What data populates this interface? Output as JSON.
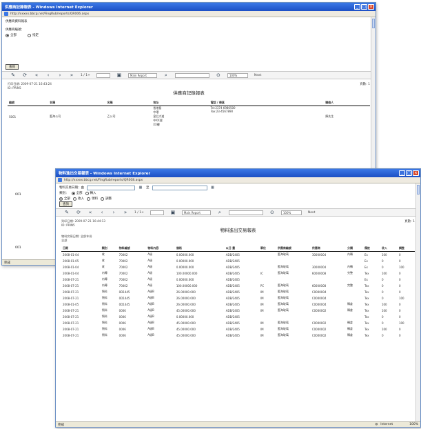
{
  "back_window": {
    "title": "供應商記錄報表 - Windows Internet Explorer",
    "url": "http://xxxxx.bbcg.net/FingRub/reports/QR006.aspx",
    "breadcrumb": "供應商資料報表",
    "filter_label": "供應商編號：",
    "radio_all": "全部",
    "radio_select": "指定",
    "query_button": "查詢",
    "toolbar": {
      "page": "1 / 1+",
      "export_format": "Main Report",
      "zoom": "100%",
      "next": "Next"
    },
    "report": {
      "print_time": "打印日期: 2009-07-21 16:43:24",
      "user": "ID: PRIN5",
      "title": "供應商記錄報表",
      "page_label": "頁數: 1"
    },
    "table": {
      "headers": [
        "編號",
        "名稱",
        "名稱",
        "地址",
        "電話 / 傳真",
        "聯絡人"
      ],
      "rows": [
        [
          "S001",
          "藍海公司",
          "乙公司",
          "香港島\n中環\n皇后大道\n中XX號\nXX樓",
          "Tel:2374 6986500\nFax:23-4567890",
          "陳先生"
        ]
      ]
    },
    "side_labels": [
      "001",
      "001"
    ],
    "status": "完成"
  },
  "front_window": {
    "title": "物料進出交易報表 - Windows Internet Explorer",
    "url": "http://xxxxx.bbcg.net/FingRub/reports/QR008.aspx",
    "filter_date_label": "物料交易日期：由",
    "filter_date_to": "至",
    "filter_type_label": "類別：",
    "type_options": [
      "全部",
      "轉入"
    ],
    "filter_kind_options": [
      "全部",
      "收入",
      "領料",
      "調整"
    ],
    "query_button": "查詢",
    "toolbar": {
      "page": "1 / 1+",
      "export_format": "Main Report",
      "zoom": "100%",
      "next": "Next"
    },
    "report": {
      "print_time": "列印日期: 2009-07-21 16:44:13",
      "user": "ID: PRIN5",
      "title": "物料進出交易報表",
      "page_label": "頁數: 1",
      "range_label": "物料交易日期: 全部年份",
      "category": "全部"
    },
    "table": {
      "headers": [
        "日期",
        "類別",
        "物料編號",
        "物料內容",
        "價格",
        "以日 量",
        "單位",
        "供應商編號",
        "供應商",
        "分類",
        "備註",
        "收入",
        "調整"
      ],
      "rows": [
        [
          "2008-01-04",
          "收",
          "70002",
          "A級",
          "0.00000.000",
          "ADB/2405",
          "",
          "藍海玻璃",
          "30000004",
          "內轉",
          "Ex",
          "100",
          "0"
        ],
        [
          "2008-01-05",
          "收",
          "70002",
          "A級",
          "0.00000.000",
          "ADB/2405",
          "",
          "",
          "",
          "",
          "Ex",
          "0",
          "0"
        ],
        [
          "2008-01-04",
          "收",
          "70002",
          "A級",
          "0.00000.000",
          "ADB/2405",
          "",
          "藍海玻璃",
          "30000004",
          "內轉",
          "Ex",
          "0",
          "100"
        ],
        [
          "2008-01-04",
          "內轉",
          "70002",
          "A級",
          "100.00000.000",
          "ADB/2405",
          "IC",
          "藍海玻璃",
          "60000008",
          "完整",
          "Tex",
          "100",
          "0"
        ],
        [
          "2008-07-21",
          "內轉",
          "70002",
          "A級",
          "0.00000.000",
          "ADB/2405",
          "",
          "",
          "",
          "",
          "Ex",
          "0",
          "0"
        ],
        [
          "2008-07-21",
          "內轉",
          "70002",
          "A級",
          "100.00000.000",
          "ADB/2405",
          "PC",
          "藍海玻璃",
          "60000008",
          "完整",
          "Tex",
          "0",
          "0"
        ],
        [
          "2008-07-21",
          "領料",
          "0D1445",
          "A級B",
          "26.00000.000",
          "ADB/2405",
          "IM",
          "藍海玻璃",
          "C0000004",
          "",
          "Tex",
          "0",
          "0"
        ],
        [
          "2008-07-21",
          "領料",
          "0D1445",
          "A級B",
          "26.00000.000",
          "ADB/2405",
          "IM",
          "藍海玻璃",
          "C0000004",
          "",
          "Tex",
          "0",
          "100"
        ],
        [
          "2008-01-05",
          "領料",
          "0D1445",
          "A級B",
          "26.00000.000",
          "ADB/2405",
          "IM",
          "藍海玻璃",
          "C0000004",
          "轉倉",
          "Tex",
          "100",
          "0"
        ],
        [
          "2008-07-21",
          "領料",
          "0006",
          "A級B",
          "45.00000.000",
          "ADB/2405",
          "IM",
          "藍海玻璃",
          "C0000002",
          "轉倉",
          "Tex",
          "100",
          "0"
        ],
        [
          "2008-07-21",
          "領料",
          "0006",
          "A級B",
          "0.00000.000",
          "ADB/2405",
          "",
          "",
          "",
          "",
          "Tex",
          "0",
          "0"
        ],
        [
          "2008-07-21",
          "領料",
          "0006",
          "A級B",
          "45.00000.000",
          "ADB/2405",
          "IM",
          "藍海玻璃",
          "C0000002",
          "轉倉",
          "Tex",
          "0",
          "100"
        ],
        [
          "2008-07-21",
          "領料",
          "0006",
          "A級B",
          "45.00000.000",
          "ADB/2405",
          "IM",
          "藍海玻璃",
          "C0000002",
          "轉倉",
          "Tex",
          "100",
          "0"
        ],
        [
          "2008-07-21",
          "領料",
          "0006",
          "A級B",
          "45.00000.000",
          "ADB/2405",
          "IM",
          "藍海玻璃",
          "C0000002",
          "轉倉",
          "Tex",
          "0",
          "0"
        ]
      ]
    },
    "status": "完成",
    "status_zone": "Internet",
    "status_zoom": "100%"
  }
}
